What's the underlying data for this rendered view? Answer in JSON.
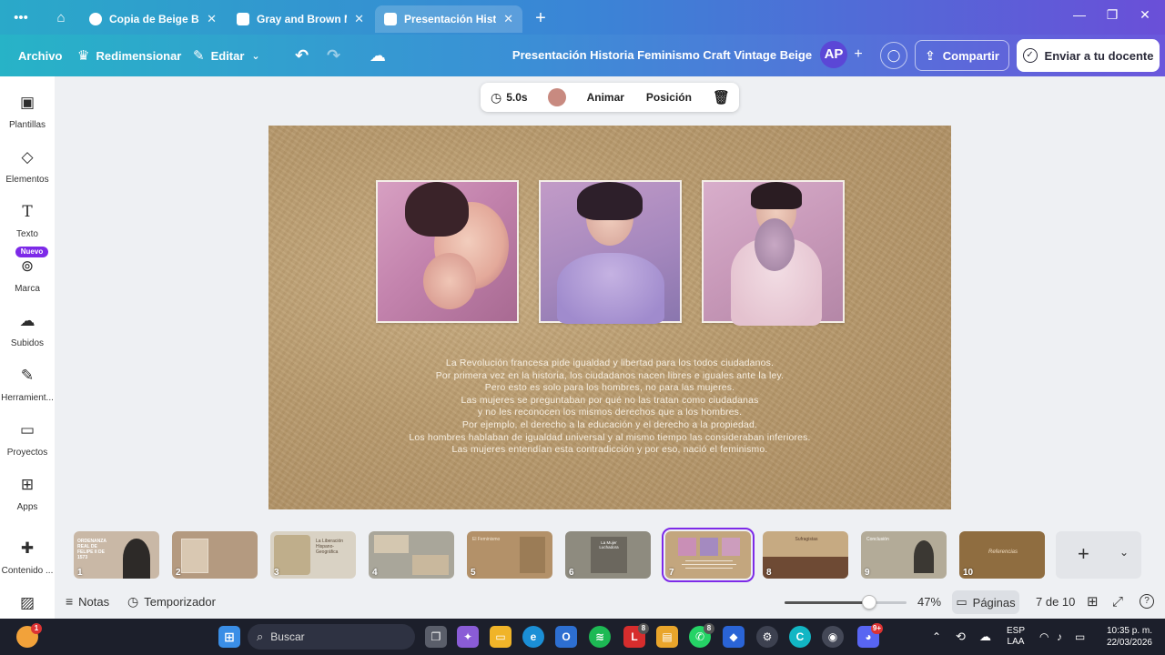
{
  "browser": {
    "tabs": [
      {
        "title": "Copia de Beige Bro...",
        "active": false
      },
      {
        "title": "Gray and Brown M...",
        "active": false
      },
      {
        "title": "Presentación Histo...",
        "active": true
      }
    ]
  },
  "toolbar": {
    "archivo": "Archivo",
    "redimensionar": "Redimensionar",
    "editar": "Editar",
    "doc_title": "Presentación Historia Feminismo Craft Vintage Beige",
    "avatar_initials": "AP",
    "share": "Compartir",
    "send": "Enviar a tu docente"
  },
  "sidebar": {
    "items": [
      {
        "label": "Plantillas",
        "icon": "templates-icon"
      },
      {
        "label": "Elementos",
        "icon": "elements-icon"
      },
      {
        "label": "Texto",
        "icon": "text-icon"
      },
      {
        "label": "Marca",
        "icon": "brand-icon"
      },
      {
        "label": "Subidos",
        "icon": "upload-icon"
      },
      {
        "label": "Herramient...",
        "icon": "tools-icon"
      },
      {
        "label": "Proyectos",
        "icon": "folder-icon"
      },
      {
        "label": "Apps",
        "icon": "apps-icon"
      },
      {
        "label": "Contenido ...",
        "icon": "content-icon"
      }
    ],
    "new_badge": "Nuevo"
  },
  "element_toolbar": {
    "duration": "5.0s",
    "color": "#c88a80",
    "animate": "Animar",
    "position": "Posición"
  },
  "slide": {
    "text_lines": [
      "La Revolución francesa pide igualdad y libertad para los todos ciudadanos.",
      "Por primera vez en la historia, los ciudadanos nacen libres e iguales ante la ley.",
      "Pero esto es solo para los hombres, no para las mujeres.",
      "Las mujeres se preguntaban por qué no las tratan como ciudadanas",
      "y no les reconocen los mismos derechos que a los hombres.",
      "Por ejemplo, el derecho a la educación y el derecho a la propiedad.",
      "Los hombres hablaban de igualdad universal y al mismo tiempo las consideraban inferiores.",
      "Las mujeres entendían esta contradicción y por eso, nació el feminismo."
    ]
  },
  "pages": [
    {
      "num": "1",
      "bg": "#c9b8a6",
      "label": "ORDENANZA REAL DE FELIPE II DE 1573"
    },
    {
      "num": "2",
      "bg": "#b49a80",
      "label": ""
    },
    {
      "num": "3",
      "bg": "#d9d2c4",
      "label": "La Liberación Hispano-Geográfica"
    },
    {
      "num": "4",
      "bg": "#a9a69a",
      "label": ""
    },
    {
      "num": "5",
      "bg": "#b39169",
      "label": "El Feminismo"
    },
    {
      "num": "6",
      "bg": "#8e8b7f",
      "label": "La Mujer Luchadora"
    },
    {
      "num": "7",
      "bg": "#c3a67e",
      "label": ""
    },
    {
      "num": "8",
      "bg": "#c6aa82",
      "label": "Sufragistas"
    },
    {
      "num": "9",
      "bg": "#b3ab98",
      "label": "Conclusión"
    },
    {
      "num": "10",
      "bg": "#8f6d40",
      "label": "Referencias"
    }
  ],
  "bottom": {
    "notes": "Notas",
    "timer": "Temporizador",
    "zoom": "47%",
    "zoom_level": 0.47,
    "pages": "Páginas",
    "page_counter": "7 de 10"
  },
  "taskbar": {
    "search": "Buscar",
    "lang1": "ESP",
    "lang2": "LAA",
    "time": "10:35 p. m.",
    "date": "22/03/2026"
  }
}
